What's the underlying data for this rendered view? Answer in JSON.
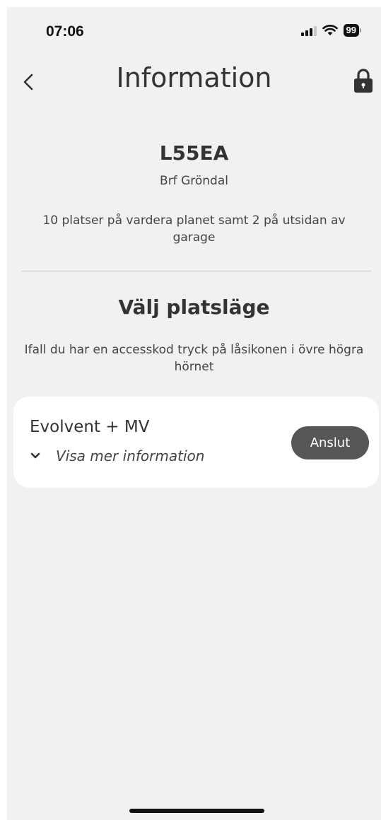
{
  "status_bar": {
    "time": "07:06",
    "battery": "99",
    "icons": [
      "signal-icon",
      "wifi-icon",
      "battery-icon"
    ]
  },
  "nav": {
    "title": "Information",
    "back_icon": "chevron-left-icon",
    "lock_icon": "lock-icon"
  },
  "site": {
    "code": "L55EA",
    "organization": "Brf Gröndal",
    "description": "10 platser på vardera planet samt 2 på utsidan av garage"
  },
  "mode_section": {
    "title": "Välj platsläge",
    "hint": "Ifall du har en accesskod tryck på låsikonen i övre högra hörnet"
  },
  "parking_options": [
    {
      "name": "Evolvent + MV",
      "more_label": "Visa mer information",
      "more_icon": "chevron-down-icon",
      "connect_label": "Anslut"
    }
  ],
  "colors": {
    "background": "#f1f1f1",
    "card": "#ffffff",
    "button": "#565656",
    "text": "#333333"
  }
}
